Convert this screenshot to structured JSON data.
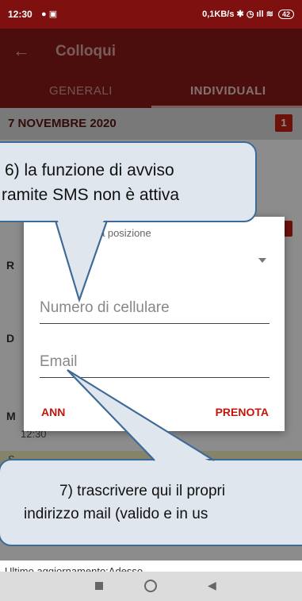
{
  "status_bar": {
    "time": "12:30",
    "network_speed": "0,1KB/s",
    "battery": "42",
    "icons": [
      "notification-icon",
      "message-icon",
      "bluetooth-icon",
      "alarm-icon",
      "signal-icon",
      "wifi-icon",
      "battery-icon"
    ]
  },
  "app_bar": {
    "back_icon": "arrow-left",
    "title": "Colloqui"
  },
  "tabs": [
    {
      "label": "GENERALI",
      "selected": false
    },
    {
      "label": "INDIVIDUALI",
      "selected": true
    }
  ],
  "list": {
    "date_header": "7 NOVEMBRE 2020",
    "date_badge": "1",
    "row_initials": [
      "R",
      "D",
      "M"
    ],
    "row_time_visible": "12:30",
    "row_prefix": [
      "S",
      "M",
      "S"
    ]
  },
  "dialog": {
    "position_label": "a posizione",
    "phone_placeholder": "Numero di cellulare",
    "email_placeholder": "Email",
    "cancel_label": "ANN",
    "confirm_label": "PRENOTA"
  },
  "callouts": {
    "sms_line1": "6) la funzione di avviso",
    "sms_line2": "ramite SMS non è attiva",
    "email_line1": "7) trascrivere qui il propri",
    "email_line2": "indirizzo mail (valido e in us"
  },
  "footer": {
    "last_update": "Ultimo aggiornamento:Adesso"
  },
  "colors": {
    "primary": "#8a1b16",
    "accent_red": "#c61f14",
    "callout_bg": "#dfe6ee",
    "callout_border": "#3e6a97"
  }
}
